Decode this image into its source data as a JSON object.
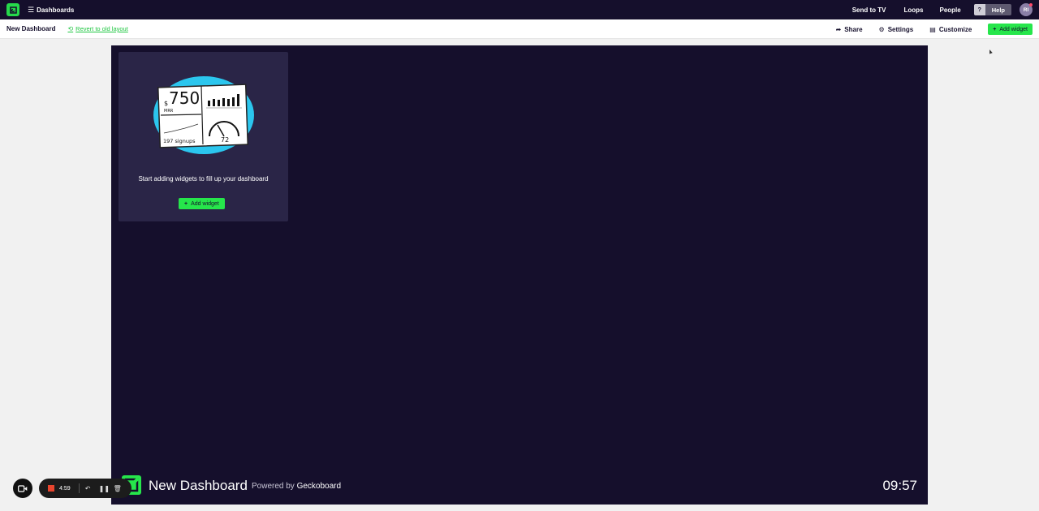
{
  "topbar": {
    "menu_label": "Dashboards",
    "links": [
      "Send to TV",
      "Loops",
      "People"
    ],
    "help_question": "?",
    "help_label": "Help",
    "avatar_initials": "RI"
  },
  "subbar": {
    "dashboard_title": "New Dashboard",
    "revert_label": "Revert to old layout",
    "share_label": "Share",
    "settings_label": "Settings",
    "customize_label": "Customize",
    "add_widget_label": "Add widget"
  },
  "canvas": {
    "empty_message": "Start adding widgets to fill up your dashboard",
    "add_widget_label": "Add widget",
    "illustration": {
      "big_number": "750",
      "currency": "$",
      "big_number_caption": "MRR",
      "signups_value": "197 signups",
      "gauge_value": "72"
    },
    "footer": {
      "name": "New Dashboard",
      "powered_prefix": "Powered by",
      "powered_brand": "Geckoboard",
      "clock": "09:57"
    }
  },
  "recorder": {
    "time": "4:59"
  },
  "colors": {
    "topbar_bg": "#150f2c",
    "canvas_bg": "#150f2c",
    "card_bg": "#2a2547",
    "accent_green": "#26e64b",
    "record_red": "#e8452e"
  }
}
